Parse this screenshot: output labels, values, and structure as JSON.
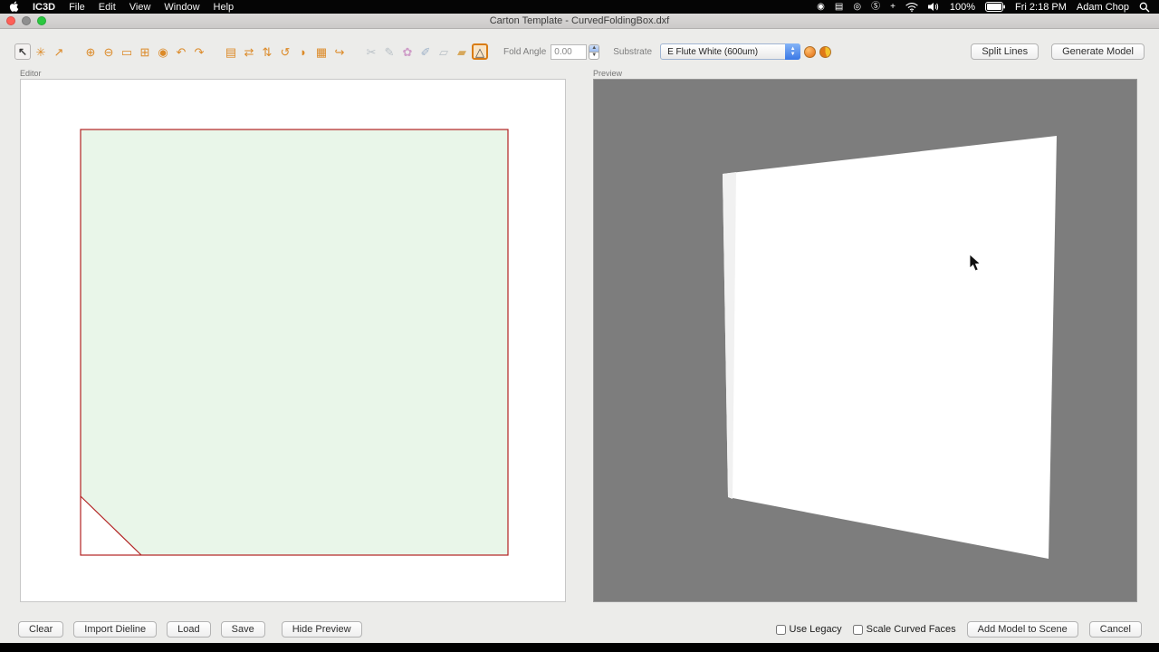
{
  "menu_bar": {
    "app_name": "IC3D",
    "menus": [
      "File",
      "Edit",
      "View",
      "Window",
      "Help"
    ],
    "status_icons": [
      {
        "name": "screen-record-icon",
        "glyph": "◉"
      },
      {
        "name": "display-icon",
        "glyph": "▤"
      },
      {
        "name": "network-icon",
        "glyph": "◎"
      },
      {
        "name": "skype-icon",
        "glyph": "Ⓢ"
      },
      {
        "name": "accessibility-icon",
        "glyph": "+"
      }
    ],
    "battery_percent": "100%",
    "clock": "Fri 2:18 PM",
    "user_name": "Adam Chop"
  },
  "window": {
    "title": "Carton Template - CurvedFoldingBox.dxf"
  },
  "toolbar": {
    "tools": [
      {
        "name": "select-tool",
        "glyph": "↖"
      },
      {
        "name": "transform-tool",
        "glyph": "✳"
      },
      {
        "name": "pan-tool",
        "glyph": "↗"
      },
      {
        "name": "zoom-in-tool",
        "glyph": "⊕"
      },
      {
        "name": "zoom-out-tool",
        "glyph": "⊖"
      },
      {
        "name": "zoom-area-tool",
        "glyph": "▭"
      },
      {
        "name": "measure-tool",
        "glyph": "⊞"
      },
      {
        "name": "fill-tool",
        "glyph": "◉"
      },
      {
        "name": "undo-tool",
        "glyph": "↶"
      },
      {
        "name": "redo-tool",
        "glyph": "↷"
      },
      {
        "name": "paste-tool",
        "glyph": "▤"
      },
      {
        "name": "flip-horizontal-tool",
        "glyph": "⇄"
      },
      {
        "name": "flip-vertical-tool",
        "glyph": "⇅"
      },
      {
        "name": "rotate-tool",
        "glyph": "↺"
      },
      {
        "name": "ellipse-tool",
        "glyph": "◗"
      },
      {
        "name": "hatch-tool",
        "glyph": "▦"
      },
      {
        "name": "curve-tool",
        "glyph": "↪"
      },
      {
        "name": "cut-tool",
        "glyph": "✂"
      },
      {
        "name": "pencil-tool",
        "glyph": "✎"
      },
      {
        "name": "flower-tool",
        "glyph": "✿"
      },
      {
        "name": "brush-tool",
        "glyph": "✐"
      },
      {
        "name": "eraser-tool",
        "glyph": "▱"
      },
      {
        "name": "fold-tool",
        "glyph": "▰"
      },
      {
        "name": "curved-fold-tool",
        "glyph": "△"
      }
    ],
    "fold_angle_label": "Fold Angle",
    "fold_angle_value": "0.00",
    "substrate_label": "Substrate",
    "substrate_value": "E Flute White (600um)",
    "split_lines_button": "Split Lines",
    "generate_model_button": "Generate Model"
  },
  "editor": {
    "label": "Editor"
  },
  "preview": {
    "label": "Preview"
  },
  "footer": {
    "clear_button": "Clear",
    "import_dieline_button": "Import Dieline",
    "load_button": "Load",
    "save_button": "Save",
    "hide_preview_button": "Hide Preview",
    "use_legacy_label": "Use Legacy",
    "scale_curved_faces_label": "Scale Curved Faces",
    "add_model_button": "Add Model to Scene",
    "cancel_button": "Cancel"
  },
  "colors": {
    "dieline_stroke": "#b22222",
    "dieline_fill": "#e9f6e9",
    "preview_background": "#7d7d7d",
    "tool_accent": "#dc8a28",
    "popup_accent": "#3a78e6"
  }
}
